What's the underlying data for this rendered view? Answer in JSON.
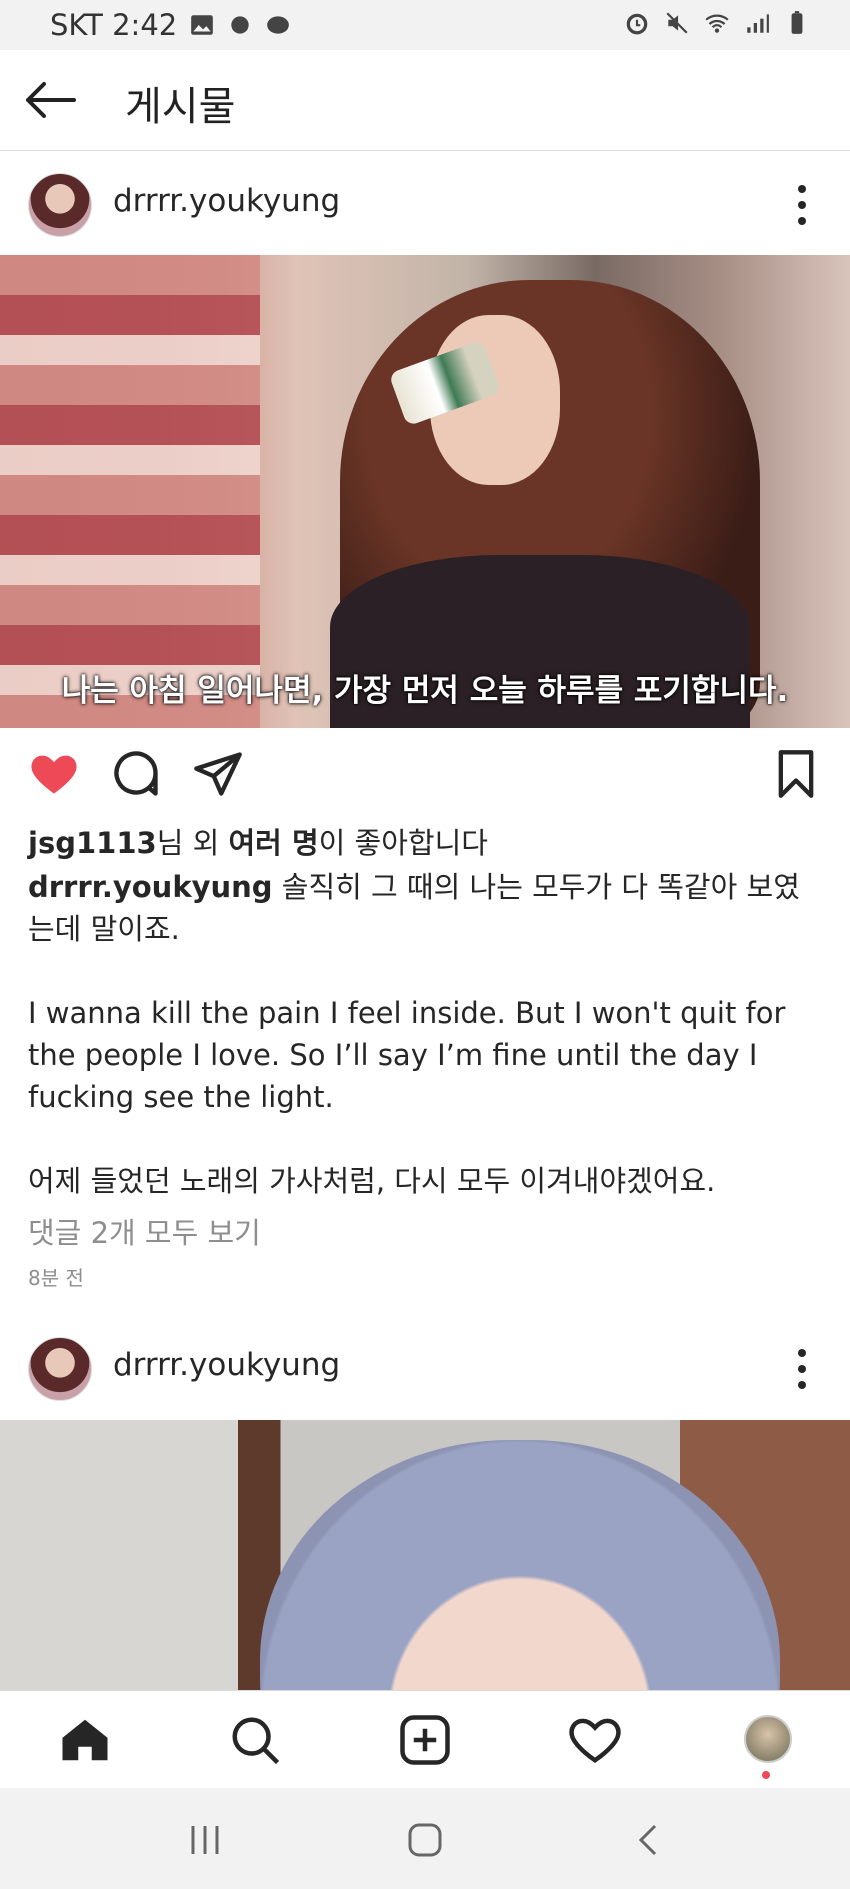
{
  "status_bar": {
    "carrier_time": "SKT 2:42"
  },
  "header": {
    "title": "게시물"
  },
  "post1": {
    "username": "drrrr.youkyung",
    "subtitle": "나는 아침 일어나면, 가장 먼저 오늘 하루를 포기합니다.",
    "liked": true,
    "likes": {
      "user": "jsg1113",
      "mid": "님 외 ",
      "others": "여러 명",
      "suffix": "이 좋아합니다"
    },
    "caption_user": "drrrr.youkyung",
    "caption_line1": " 솔직히 그 때의 나는 모두가 다 똑같아 보였는데 말이죠.",
    "caption_para2": "I wanna kill the pain I feel inside. But I won't quit for the people I love. So I’ll say I’m fine until the day I fucking see the light.",
    "caption_para3": "어제 들었던 노래의 가사처럼, 다시 모두 이겨내야겠어요.",
    "view_comments": "댓글 2개 모두 보기",
    "time_ago": "8분 전"
  },
  "post2": {
    "username": "drrrr.youkyung"
  },
  "colors": {
    "like_red": "#ed4956",
    "text": "#262626",
    "muted": "#8e8e8e"
  }
}
